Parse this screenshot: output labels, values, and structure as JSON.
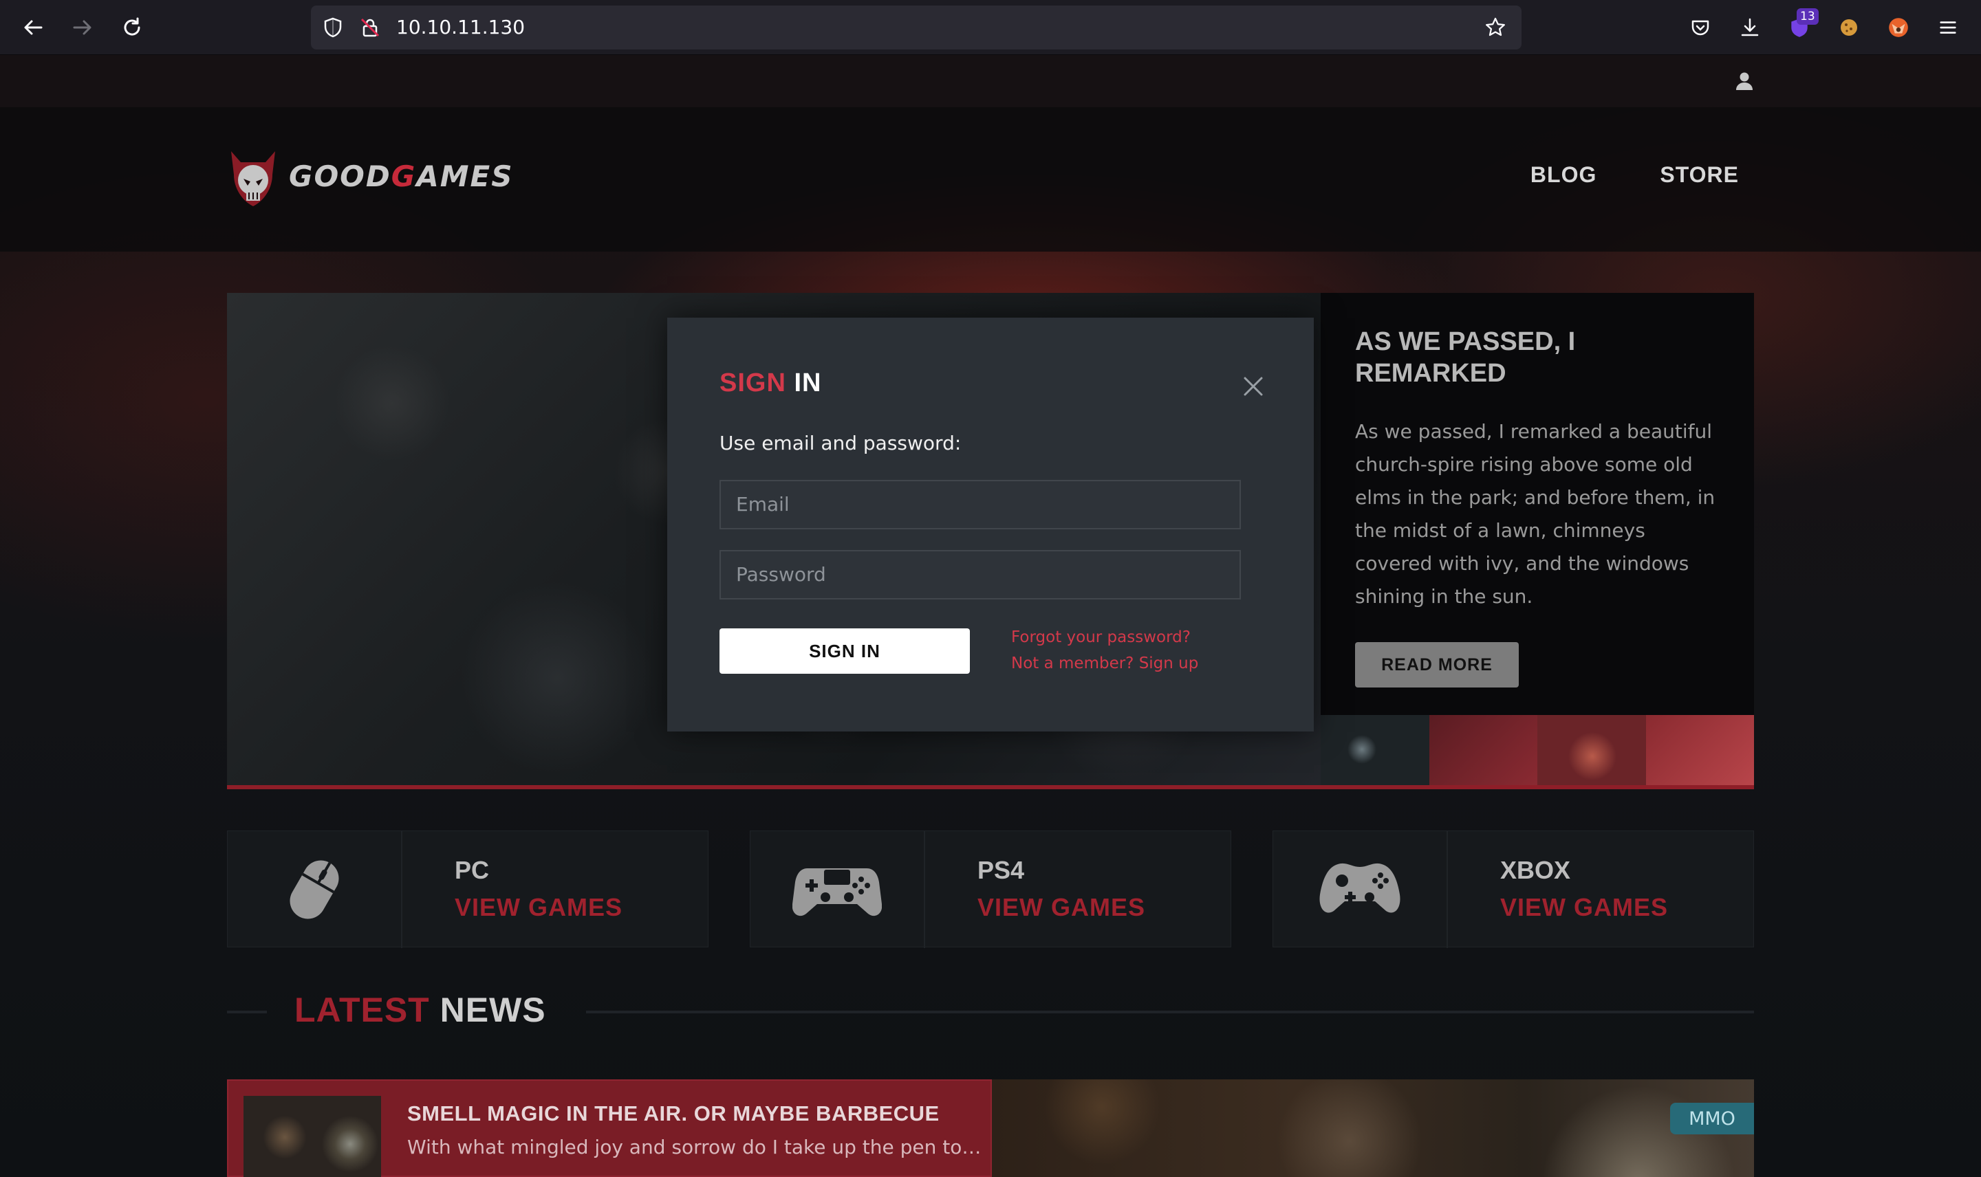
{
  "browser": {
    "url": "10.10.11.130",
    "extension_badge": "13"
  },
  "site": {
    "brand_prefix": "GOOD",
    "brand_g": "G",
    "brand_suffix": "AMES",
    "nav": [
      "BLOG",
      "STORE"
    ]
  },
  "slider": {
    "side_title": "AS WE PASSED, I REMARKED",
    "side_text": "As we passed, I remarked a beautiful church-spire rising above some old elms in the park; and before them, in the midst of a lawn, chimneys covered with ivy, and the windows shining in the sun.",
    "read_more": "READ MORE",
    "current_slide": "4"
  },
  "signin_modal": {
    "title_red": "SIGN",
    "title_white": "IN",
    "subtitle": "Use email and password:",
    "email_placeholder": "Email",
    "password_placeholder": "Password",
    "submit_label": "SIGN IN",
    "forgot_link": "Forgot your password?",
    "signup_link": "Not a member? Sign up"
  },
  "platforms": [
    {
      "name": "PC",
      "link": "VIEW GAMES",
      "icon": "mouse-icon"
    },
    {
      "name": "PS4",
      "link": "VIEW GAMES",
      "icon": "ps4-controller-icon"
    },
    {
      "name": "XBOX",
      "link": "VIEW GAMES",
      "icon": "xbox-controller-icon"
    }
  ],
  "news": {
    "heading_red": "LATEST",
    "heading_white": "NEWS",
    "items": [
      {
        "title": "SMELL MAGIC IN THE AIR. OR MAYBE BARBECUE",
        "excerpt": "With what mingled joy and sorrow do I take up the pen to w...",
        "tag": "MMO"
      }
    ]
  },
  "colors": {
    "accent_red": "#d3394a",
    "dark_red": "#a0222e",
    "modal_bg": "#2b3036",
    "tag_teal": "#276a78"
  }
}
